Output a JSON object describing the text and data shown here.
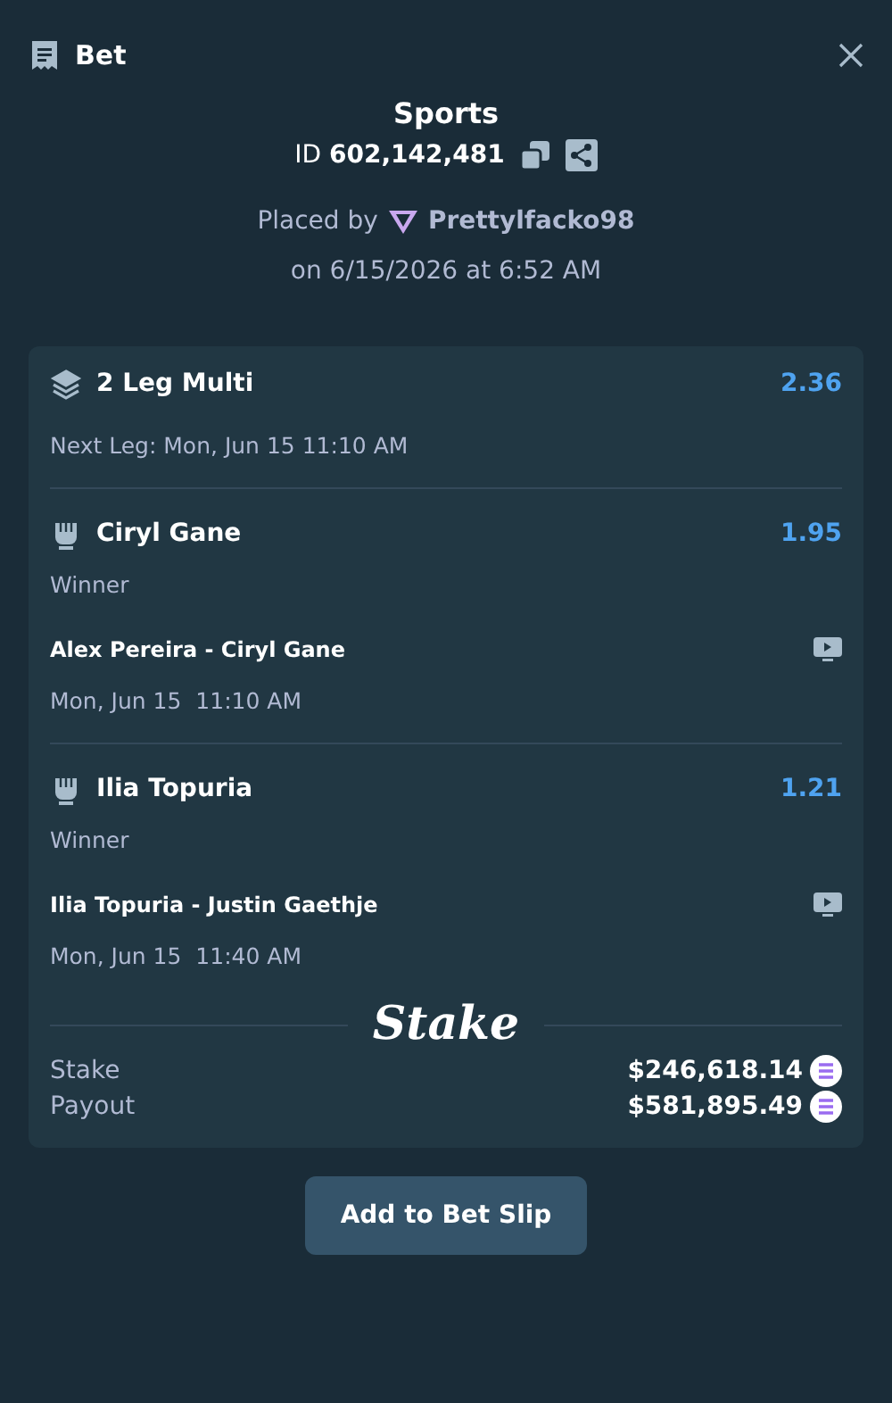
{
  "header": {
    "title": "Bet"
  },
  "summary": {
    "category": "Sports",
    "id_line": "ID **602,142,481**",
    "placed_by": "Placed by",
    "user": "Prettylfacko98",
    "placed_on": "on 6/15/2026 at 6:52 AM"
  },
  "bet": {
    "kind": "multi",
    "title": "2 Leg Multi",
    "odds": "2.36",
    "next_leg": "Next Leg: Mon, Jun 15 11:10 AM"
  },
  "legs": [
    {
      "kind": "fight",
      "name": "Ciryl Gane",
      "odds": "1.95",
      "market": "Winner",
      "event": "Alex Pereira - Ciryl Gane",
      "time": "Mon, Jun 15  11:10 AM"
    },
    {
      "kind": "fight",
      "name": "Ilia Topuria",
      "odds": "1.21",
      "market": "Winner",
      "event": "Ilia Topuria - Justin Gaethje",
      "time": "Mon, Jun 15  11:40 AM"
    }
  ],
  "logo": "Stake",
  "totals": [
    {
      "label": "Stake",
      "amount": "$246,618.14"
    },
    {
      "label": "Payout",
      "amount": "$581,895.49"
    }
  ],
  "button": "Add to Bet Slip"
}
